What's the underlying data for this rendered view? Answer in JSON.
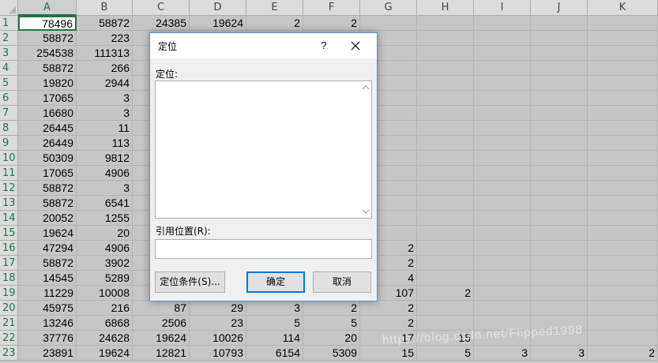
{
  "columns": [
    "A",
    "B",
    "C",
    "D",
    "E",
    "F",
    "G",
    "H",
    "I",
    "J",
    "K"
  ],
  "active_column": "A",
  "rows": [
    {
      "num": "1",
      "cells": [
        "78496",
        "58872",
        "24385",
        "19624",
        "2",
        "2",
        "",
        "",
        "",
        "",
        ""
      ]
    },
    {
      "num": "2",
      "cells": [
        "58872",
        "223",
        "",
        "",
        "",
        "",
        "",
        "",
        "",
        "",
        ""
      ]
    },
    {
      "num": "3",
      "cells": [
        "254538",
        "111313",
        "",
        "",
        "",
        "",
        "",
        "",
        "",
        "",
        ""
      ]
    },
    {
      "num": "4",
      "cells": [
        "58872",
        "266",
        "",
        "",
        "",
        "",
        "",
        "",
        "",
        "",
        ""
      ]
    },
    {
      "num": "5",
      "cells": [
        "19820",
        "2944",
        "",
        "",
        "",
        "",
        "",
        "",
        "",
        "",
        ""
      ]
    },
    {
      "num": "6",
      "cells": [
        "17065",
        "3",
        "",
        "",
        "",
        "",
        "",
        "",
        "",
        "",
        ""
      ]
    },
    {
      "num": "7",
      "cells": [
        "16680",
        "3",
        "",
        "",
        "",
        "",
        "",
        "",
        "",
        "",
        ""
      ]
    },
    {
      "num": "8",
      "cells": [
        "26445",
        "11",
        "",
        "",
        "",
        "",
        "",
        "",
        "",
        "",
        ""
      ]
    },
    {
      "num": "9",
      "cells": [
        "26449",
        "113",
        "",
        "",
        "",
        "",
        "",
        "",
        "",
        "",
        ""
      ]
    },
    {
      "num": "10",
      "cells": [
        "50309",
        "9812",
        "",
        "",
        "",
        "",
        "",
        "",
        "",
        "",
        ""
      ]
    },
    {
      "num": "11",
      "cells": [
        "17065",
        "4906",
        "",
        "",
        "",
        "",
        "",
        "",
        "",
        "",
        ""
      ]
    },
    {
      "num": "12",
      "cells": [
        "58872",
        "3",
        "",
        "",
        "",
        "",
        "",
        "",
        "",
        "",
        ""
      ]
    },
    {
      "num": "13",
      "cells": [
        "58872",
        "6541",
        "",
        "",
        "",
        "",
        "",
        "",
        "",
        "",
        ""
      ]
    },
    {
      "num": "14",
      "cells": [
        "20052",
        "1255",
        "",
        "",
        "",
        "",
        "",
        "",
        "",
        "",
        ""
      ]
    },
    {
      "num": "15",
      "cells": [
        "19624",
        "20",
        "",
        "",
        "",
        "",
        "",
        "",
        "",
        "",
        ""
      ]
    },
    {
      "num": "16",
      "cells": [
        "47294",
        "4906",
        "",
        "",
        "",
        "",
        "2",
        "",
        "",
        "",
        ""
      ]
    },
    {
      "num": "17",
      "cells": [
        "58872",
        "3902",
        "",
        "",
        "",
        "",
        "2",
        "",
        "",
        "",
        ""
      ]
    },
    {
      "num": "18",
      "cells": [
        "14545",
        "5289",
        "",
        "",
        "",
        "",
        "4",
        "",
        "",
        "",
        ""
      ]
    },
    {
      "num": "19",
      "cells": [
        "11229",
        "10008",
        "",
        "",
        "",
        "",
        "107",
        "2",
        "",
        "",
        ""
      ]
    },
    {
      "num": "20",
      "cells": [
        "45975",
        "216",
        "87",
        "29",
        "3",
        "2",
        "2",
        "",
        "",
        "",
        ""
      ]
    },
    {
      "num": "21",
      "cells": [
        "13246",
        "6868",
        "2506",
        "23",
        "5",
        "5",
        "2",
        "",
        "",
        "",
        ""
      ]
    },
    {
      "num": "22",
      "cells": [
        "37776",
        "24628",
        "19624",
        "10026",
        "114",
        "20",
        "17",
        "15",
        "",
        "",
        ""
      ]
    },
    {
      "num": "23",
      "cells": [
        "23891",
        "19624",
        "12821",
        "10793",
        "6154",
        "5309",
        "15",
        "5",
        "3",
        "3",
        "2"
      ]
    }
  ],
  "dialog": {
    "title": "定位",
    "help_label": "?",
    "goto_label": "定位:",
    "reference_label": "引用位置(R):",
    "reference_value": "",
    "special_button": "定位条件(S)...",
    "ok_button": "确定",
    "cancel_button": "取消"
  },
  "watermark": "https://blog.csdn.net/Flipped1998",
  "colors": {
    "accent": "#217346",
    "dialog_border": "#5a8fd6",
    "focus": "#0078d7"
  }
}
